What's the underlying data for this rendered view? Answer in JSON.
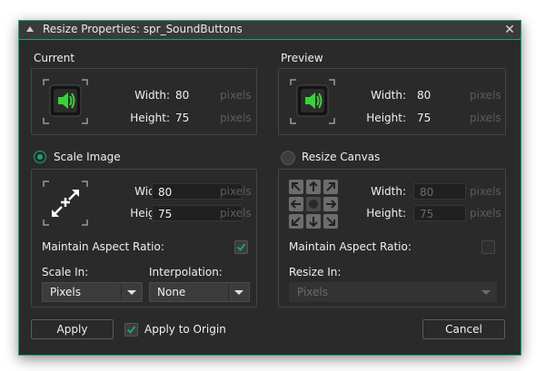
{
  "window": {
    "title": "Resize Properties: spr_SoundButtons",
    "close_symbol": "✕"
  },
  "current": {
    "heading": "Current",
    "width_label": "Width:",
    "width_value": "80",
    "height_label": "Height:",
    "height_value": "75",
    "unit": "pixels"
  },
  "preview": {
    "heading": "Preview",
    "width_label": "Width:",
    "width_value": "80",
    "height_label": "Height:",
    "height_value": "75",
    "unit": "pixels"
  },
  "scale_image": {
    "label": "Scale Image",
    "selected": true,
    "width_label": "Width:",
    "width_value": "80",
    "height_label": "Height:",
    "height_value": "75",
    "unit": "pixels",
    "aspect_label": "Maintain Aspect Ratio:",
    "aspect_checked": true,
    "scale_in_label": "Scale In:",
    "scale_in_value": "Pixels",
    "interpolation_label": "Interpolation:",
    "interpolation_value": "None"
  },
  "resize_canvas": {
    "label": "Resize Canvas",
    "selected": false,
    "width_label": "Width:",
    "width_value": "80",
    "height_label": "Height:",
    "height_value": "75",
    "unit": "pixels",
    "aspect_label": "Maintain Aspect Ratio:",
    "aspect_checked": false,
    "resize_in_label": "Resize In:",
    "resize_in_value": "Pixels"
  },
  "footer": {
    "apply_label": "Apply",
    "apply_origin_label": "Apply to Origin",
    "apply_origin_checked": true,
    "cancel_label": "Cancel"
  },
  "colors": {
    "accent": "#1aa07a",
    "dialog_bg": "#2a2a2a",
    "speaker_green": "#3ad23a"
  }
}
